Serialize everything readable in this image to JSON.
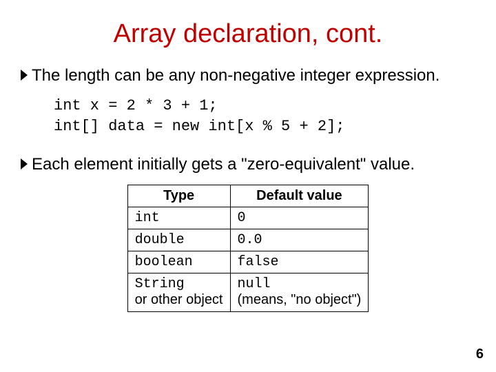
{
  "title": "Array declaration, cont.",
  "bullets": {
    "b1": "The length can be any non-negative integer expression.",
    "b2": "Each element initially gets a \"zero-equivalent\" value."
  },
  "code": "int x = 2 * 3 + 1;\nint[] data = new int[x % 5 + 2];",
  "table": {
    "headers": {
      "type": "Type",
      "value": "Default value"
    },
    "rows": [
      {
        "type_code": "int",
        "type_note": "",
        "val_code": "0",
        "val_note": ""
      },
      {
        "type_code": "double",
        "type_note": "",
        "val_code": "0.0",
        "val_note": ""
      },
      {
        "type_code": "boolean",
        "type_note": "",
        "val_code": "false",
        "val_note": ""
      },
      {
        "type_code": "String",
        "type_note": "or other object",
        "val_code": "null",
        "val_note": "(means, \"no object\")"
      }
    ]
  },
  "page_number": "6"
}
